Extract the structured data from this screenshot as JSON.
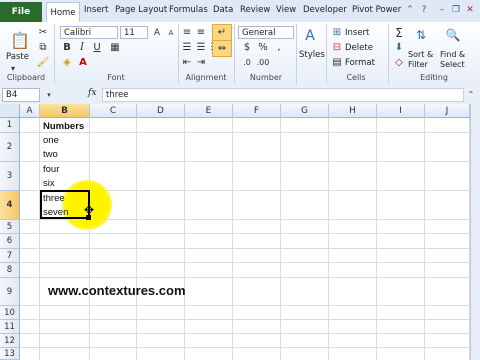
{
  "tabs": [
    "File",
    "Home",
    "Insert",
    "Page Layout",
    "Formulas",
    "Data",
    "Review",
    "View",
    "Developer",
    "Pivot Power"
  ],
  "ribbon": {
    "clipboard": {
      "paste": "Paste",
      "group": "Clipboard"
    },
    "font": {
      "name": "Calibri",
      "size": "11",
      "group": "Font"
    },
    "alignment": {
      "group": "Alignment"
    },
    "number": {
      "format": "General",
      "group": "Number",
      "dollar": "$",
      "percent": "%",
      "comma": ","
    },
    "styles": {
      "label": "Styles"
    },
    "cells": {
      "insert": "Insert",
      "delete": "Delete",
      "format": "Format",
      "group": "Cells"
    },
    "editing": {
      "sort": "Sort &",
      "sort2": "Filter",
      "find": "Find &",
      "find2": "Select",
      "group": "Editing"
    }
  },
  "formula_bar": {
    "name_box": "B4",
    "fx": "fx",
    "content": "three"
  },
  "columns": [
    "A",
    "B",
    "C",
    "D",
    "E",
    "F",
    "G",
    "H",
    "I",
    "J"
  ],
  "rows": [
    "1",
    "2",
    "3",
    "4",
    "5",
    "6",
    "7",
    "8",
    "9",
    "10",
    "11",
    "12",
    "13"
  ],
  "cells": {
    "b1": "Numbers",
    "b2a": "one",
    "b2b": "two",
    "b3a": "four",
    "b3b": "six",
    "b4a": "three",
    "b4b": "seven"
  },
  "watermark": "www.contextures.com",
  "colors": {
    "file_tab": "#2a6a2a",
    "highlight": "#fff400"
  }
}
